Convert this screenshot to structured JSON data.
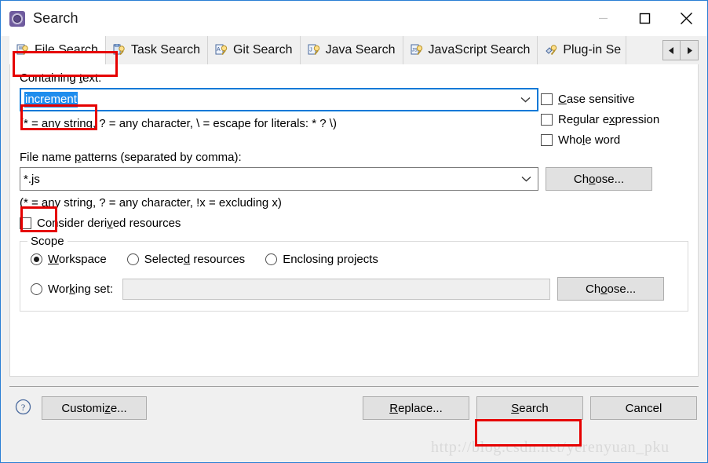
{
  "window": {
    "title": "Search",
    "icon": "search-gear-icon",
    "controls": {
      "minimize": "Minimize",
      "maximize": "Maximize",
      "close": "Close"
    },
    "accent_color": "#2a7fd4"
  },
  "tabs": {
    "selected_index": 0,
    "items": [
      {
        "label": "File Search",
        "icon": "file-search-icon"
      },
      {
        "label": "Task Search",
        "icon": "task-search-icon"
      },
      {
        "label": "Git Search",
        "icon": "git-search-icon"
      },
      {
        "label": "Java Search",
        "icon": "java-search-icon"
      },
      {
        "label": "JavaScript Search",
        "icon": "javascript-search-icon"
      },
      {
        "label": "Plug-in Se",
        "icon": "plugin-search-icon"
      }
    ],
    "scroll_left": "◀",
    "scroll_right": "▶"
  },
  "form": {
    "containing_text_label_pre": "Containing ",
    "containing_text_label_mn": "t",
    "containing_text_label_post": "ext:",
    "containing_text_value": "increment",
    "containing_text_hint": "(* = any string, ? = any character, \\ = escape for literals: * ? \\)",
    "options": [
      {
        "pre": "",
        "mn": "C",
        "post": "ase sensitive",
        "checked": false
      },
      {
        "pre": "Regular e",
        "mn": "x",
        "post": "pression",
        "checked": false
      },
      {
        "pre": "Who",
        "mn": "l",
        "post": "e word",
        "checked": false
      }
    ],
    "patterns_label_pre": "File name ",
    "patterns_label_mn": "p",
    "patterns_label_post": "atterns (separated by comma):",
    "patterns_value": "*.js",
    "patterns_hint": "(* = any string, ? = any character, !x = excluding x)",
    "choose_pattern_button": {
      "pre": "Ch",
      "mn": "o",
      "post": "ose..."
    },
    "derived_resources": {
      "pre": "Consider deri",
      "mn": "v",
      "post": "ed resources",
      "checked": false
    }
  },
  "scope": {
    "title": "Scope",
    "radios": [
      {
        "pre": "",
        "mn": "W",
        "post": "orkspace",
        "checked": true
      },
      {
        "pre": "Selecte",
        "mn": "d",
        "post": " resources",
        "checked": false
      },
      {
        "pre": "Enclosing projects",
        "mn": "",
        "post": "",
        "checked": false
      }
    ],
    "working_set": {
      "pre": "Wor",
      "mn": "k",
      "post": "ing set:",
      "checked": false
    },
    "working_set_value": "",
    "choose_button": {
      "pre": "Ch",
      "mn": "o",
      "post": "ose..."
    }
  },
  "footer": {
    "help_icon": "help-icon",
    "customize": {
      "pre": "Customi",
      "mn": "z",
      "post": "e..."
    },
    "replace": {
      "pre": "",
      "mn": "R",
      "post": "eplace..."
    },
    "search": {
      "pre": "",
      "mn": "S",
      "post": "earch"
    },
    "cancel": {
      "pre": "Cancel",
      "mn": "",
      "post": ""
    }
  },
  "annotations": {
    "color": "#e60000",
    "boxes": [
      "file-search-tab",
      "containing-text-value",
      "patterns-value",
      "search-button"
    ]
  },
  "watermark": "http://blog.csdn.net/yerenyuan_pku"
}
